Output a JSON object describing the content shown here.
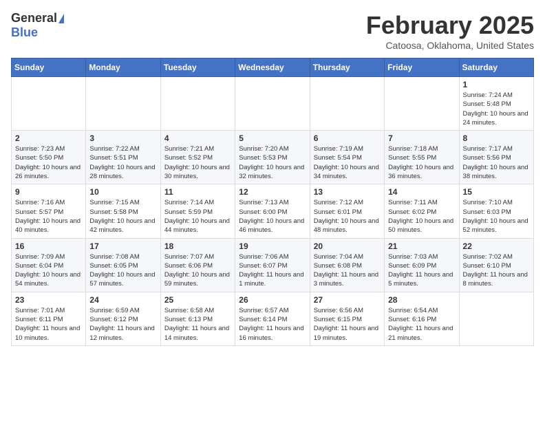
{
  "logo": {
    "general": "General",
    "blue": "Blue"
  },
  "title": "February 2025",
  "location": "Catoosa, Oklahoma, United States",
  "days_of_week": [
    "Sunday",
    "Monday",
    "Tuesday",
    "Wednesday",
    "Thursday",
    "Friday",
    "Saturday"
  ],
  "weeks": [
    [
      {
        "day": "",
        "info": ""
      },
      {
        "day": "",
        "info": ""
      },
      {
        "day": "",
        "info": ""
      },
      {
        "day": "",
        "info": ""
      },
      {
        "day": "",
        "info": ""
      },
      {
        "day": "",
        "info": ""
      },
      {
        "day": "1",
        "info": "Sunrise: 7:24 AM\nSunset: 5:48 PM\nDaylight: 10 hours and 24 minutes."
      }
    ],
    [
      {
        "day": "2",
        "info": "Sunrise: 7:23 AM\nSunset: 5:50 PM\nDaylight: 10 hours and 26 minutes."
      },
      {
        "day": "3",
        "info": "Sunrise: 7:22 AM\nSunset: 5:51 PM\nDaylight: 10 hours and 28 minutes."
      },
      {
        "day": "4",
        "info": "Sunrise: 7:21 AM\nSunset: 5:52 PM\nDaylight: 10 hours and 30 minutes."
      },
      {
        "day": "5",
        "info": "Sunrise: 7:20 AM\nSunset: 5:53 PM\nDaylight: 10 hours and 32 minutes."
      },
      {
        "day": "6",
        "info": "Sunrise: 7:19 AM\nSunset: 5:54 PM\nDaylight: 10 hours and 34 minutes."
      },
      {
        "day": "7",
        "info": "Sunrise: 7:18 AM\nSunset: 5:55 PM\nDaylight: 10 hours and 36 minutes."
      },
      {
        "day": "8",
        "info": "Sunrise: 7:17 AM\nSunset: 5:56 PM\nDaylight: 10 hours and 38 minutes."
      }
    ],
    [
      {
        "day": "9",
        "info": "Sunrise: 7:16 AM\nSunset: 5:57 PM\nDaylight: 10 hours and 40 minutes."
      },
      {
        "day": "10",
        "info": "Sunrise: 7:15 AM\nSunset: 5:58 PM\nDaylight: 10 hours and 42 minutes."
      },
      {
        "day": "11",
        "info": "Sunrise: 7:14 AM\nSunset: 5:59 PM\nDaylight: 10 hours and 44 minutes."
      },
      {
        "day": "12",
        "info": "Sunrise: 7:13 AM\nSunset: 6:00 PM\nDaylight: 10 hours and 46 minutes."
      },
      {
        "day": "13",
        "info": "Sunrise: 7:12 AM\nSunset: 6:01 PM\nDaylight: 10 hours and 48 minutes."
      },
      {
        "day": "14",
        "info": "Sunrise: 7:11 AM\nSunset: 6:02 PM\nDaylight: 10 hours and 50 minutes."
      },
      {
        "day": "15",
        "info": "Sunrise: 7:10 AM\nSunset: 6:03 PM\nDaylight: 10 hours and 52 minutes."
      }
    ],
    [
      {
        "day": "16",
        "info": "Sunrise: 7:09 AM\nSunset: 6:04 PM\nDaylight: 10 hours and 54 minutes."
      },
      {
        "day": "17",
        "info": "Sunrise: 7:08 AM\nSunset: 6:05 PM\nDaylight: 10 hours and 57 minutes."
      },
      {
        "day": "18",
        "info": "Sunrise: 7:07 AM\nSunset: 6:06 PM\nDaylight: 10 hours and 59 minutes."
      },
      {
        "day": "19",
        "info": "Sunrise: 7:06 AM\nSunset: 6:07 PM\nDaylight: 11 hours and 1 minute."
      },
      {
        "day": "20",
        "info": "Sunrise: 7:04 AM\nSunset: 6:08 PM\nDaylight: 11 hours and 3 minutes."
      },
      {
        "day": "21",
        "info": "Sunrise: 7:03 AM\nSunset: 6:09 PM\nDaylight: 11 hours and 5 minutes."
      },
      {
        "day": "22",
        "info": "Sunrise: 7:02 AM\nSunset: 6:10 PM\nDaylight: 11 hours and 8 minutes."
      }
    ],
    [
      {
        "day": "23",
        "info": "Sunrise: 7:01 AM\nSunset: 6:11 PM\nDaylight: 11 hours and 10 minutes."
      },
      {
        "day": "24",
        "info": "Sunrise: 6:59 AM\nSunset: 6:12 PM\nDaylight: 11 hours and 12 minutes."
      },
      {
        "day": "25",
        "info": "Sunrise: 6:58 AM\nSunset: 6:13 PM\nDaylight: 11 hours and 14 minutes."
      },
      {
        "day": "26",
        "info": "Sunrise: 6:57 AM\nSunset: 6:14 PM\nDaylight: 11 hours and 16 minutes."
      },
      {
        "day": "27",
        "info": "Sunrise: 6:56 AM\nSunset: 6:15 PM\nDaylight: 11 hours and 19 minutes."
      },
      {
        "day": "28",
        "info": "Sunrise: 6:54 AM\nSunset: 6:16 PM\nDaylight: 11 hours and 21 minutes."
      },
      {
        "day": "",
        "info": ""
      }
    ]
  ]
}
